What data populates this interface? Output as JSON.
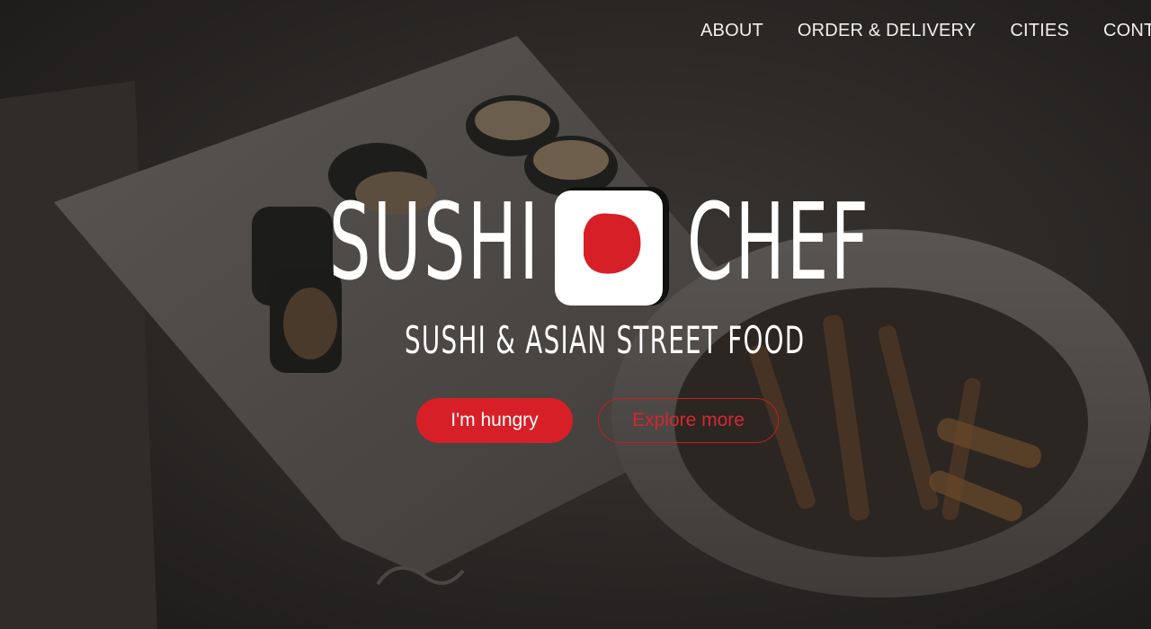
{
  "nav": {
    "items": [
      {
        "label": "ABOUT"
      },
      {
        "label": "ORDER & DELIVERY"
      },
      {
        "label": "CITIES"
      },
      {
        "label": "CONTACT"
      }
    ]
  },
  "logo": {
    "word_left": "SUSHI",
    "word_right": "CHEF",
    "tagline": "SUSHI & ASIAN STREET FOOD",
    "mark_icon": "red-dot-in-white-square-icon"
  },
  "hero": {
    "primary_button": "I'm hungry",
    "secondary_button": "Explore more",
    "background_image": "sushi-rolls-on-plate-and-bowl-photo"
  },
  "colors": {
    "brand_red": "#d71f28",
    "text_white": "#ffffff",
    "overlay_dark": "#1c1a19"
  }
}
